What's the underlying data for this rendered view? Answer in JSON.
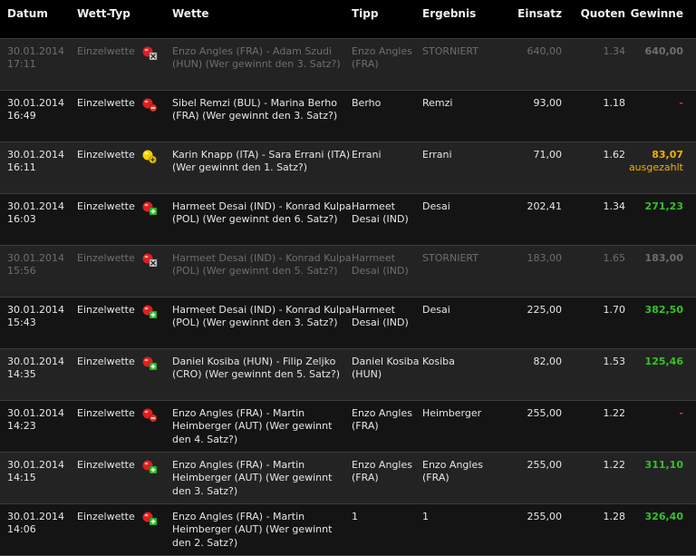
{
  "headers": {
    "datum": "Datum",
    "wett_typ": "Wett-Typ",
    "wette": "Wette",
    "tipp": "Tipp",
    "ergebnis": "Ergebnis",
    "einsatz": "Einsatz",
    "quoten": "Quoten",
    "gewinne": "Gewinne"
  },
  "rows": [
    {
      "date": "30.01.2014",
      "time": "17:11",
      "type": "Einzelwette",
      "status": "storniert",
      "wette": "Enzo Angles (FRA) - Adam Szudi (HUN) (Wer gewinnt den 3. Satz?)",
      "tipp": "Enzo Angles (FRA)",
      "ergebnis": "STORNIERT",
      "einsatz": "640,00",
      "quote": "1.34",
      "gewinn": "640,00",
      "gewinn_note": ""
    },
    {
      "date": "30.01.2014",
      "time": "16:49",
      "type": "Einzelwette",
      "status": "verloren",
      "wette": "Sibel Remzi (BUL) - Marina Berho (FRA) (Wer gewinnt den 3. Satz?)",
      "tipp": "Berho",
      "ergebnis": "Remzi",
      "einsatz": "93,00",
      "quote": "1.18",
      "gewinn": "-",
      "gewinn_note": ""
    },
    {
      "date": "30.01.2014",
      "time": "16:11",
      "type": "Einzelwette",
      "status": "ausgezahlt",
      "wette": "Karin Knapp (ITA) - Sara Errani (ITA) (Wer gewinnt den 1. Satz?)",
      "tipp": "Errani",
      "ergebnis": "Errani",
      "einsatz": "71,00",
      "quote": "1.62",
      "gewinn": "83,07",
      "gewinn_note": "ausgezahlt"
    },
    {
      "date": "30.01.2014",
      "time": "16:03",
      "type": "Einzelwette",
      "status": "gewonnen",
      "wette": "Harmeet Desai (IND) - Konrad Kulpa (POL) (Wer gewinnt den 6. Satz?)",
      "tipp": "Harmeet Desai (IND)",
      "ergebnis": "Desai",
      "einsatz": "202,41",
      "quote": "1.34",
      "gewinn": "271,23",
      "gewinn_note": ""
    },
    {
      "date": "30.01.2014",
      "time": "15:56",
      "type": "Einzelwette",
      "status": "storniert",
      "wette": "Harmeet Desai (IND) - Konrad Kulpa (POL) (Wer gewinnt den 5. Satz?)",
      "tipp": "Harmeet Desai (IND)",
      "ergebnis": "STORNIERT",
      "einsatz": "183,00",
      "quote": "1.65",
      "gewinn": "183,00",
      "gewinn_note": ""
    },
    {
      "date": "30.01.2014",
      "time": "15:43",
      "type": "Einzelwette",
      "status": "gewonnen",
      "wette": "Harmeet Desai (IND) - Konrad Kulpa (POL) (Wer gewinnt den 3. Satz?)",
      "tipp": "Harmeet Desai (IND)",
      "ergebnis": "Desai",
      "einsatz": "225,00",
      "quote": "1.70",
      "gewinn": "382,50",
      "gewinn_note": ""
    },
    {
      "date": "30.01.2014",
      "time": "14:35",
      "type": "Einzelwette",
      "status": "gewonnen",
      "wette": "Daniel Kosiba (HUN) - Filip Zeljko (CRO) (Wer gewinnt den 5. Satz?)",
      "tipp": "Daniel Kosiba (HUN)",
      "ergebnis": "Kosiba",
      "einsatz": "82,00",
      "quote": "1.53",
      "gewinn": "125,46",
      "gewinn_note": ""
    },
    {
      "date": "30.01.2014",
      "time": "14:23",
      "type": "Einzelwette",
      "status": "verloren",
      "wette": "Enzo Angles (FRA) - Martin Heimberger (AUT) (Wer gewinnt den 4. Satz?)",
      "tipp": "Enzo Angles (FRA)",
      "ergebnis": "Heimberger",
      "einsatz": "255,00",
      "quote": "1.22",
      "gewinn": "-",
      "gewinn_note": ""
    },
    {
      "date": "30.01.2014",
      "time": "14:15",
      "type": "Einzelwette",
      "status": "gewonnen",
      "wette": "Enzo Angles (FRA) - Martin Heimberger (AUT) (Wer gewinnt den 3. Satz?)",
      "tipp": "Enzo Angles (FRA)",
      "ergebnis": "Enzo Angles (FRA)",
      "einsatz": "255,00",
      "quote": "1.22",
      "gewinn": "311,10",
      "gewinn_note": ""
    },
    {
      "date": "30.01.2014",
      "time": "14:06",
      "type": "Einzelwette",
      "status": "gewonnen",
      "wette": "Enzo Angles (FRA) - Martin Heimberger (AUT) (Wer gewinnt den 2. Satz?)",
      "tipp": "1",
      "ergebnis": "1",
      "einsatz": "255,00",
      "quote": "1.28",
      "gewinn": "326,40",
      "gewinn_note": ""
    }
  ],
  "colors": {
    "win": "#35c228",
    "lose": "#d23a2a",
    "pending": "#f2b100",
    "cancelled": "#6e6e6e"
  }
}
